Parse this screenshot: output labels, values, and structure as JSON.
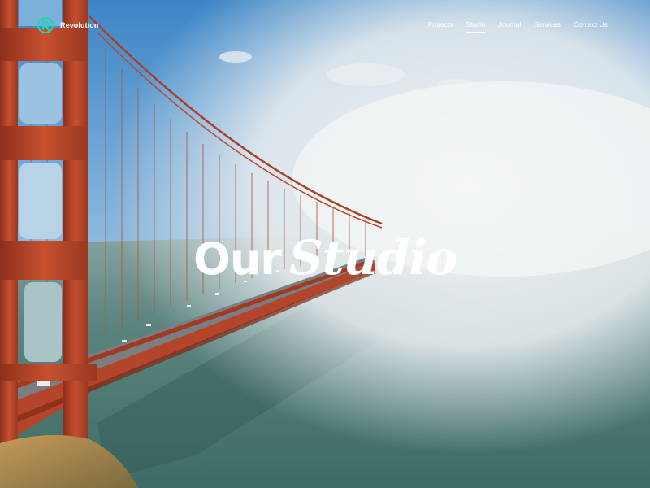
{
  "brand": {
    "name": "Revolution",
    "logo_icon": "r-logo-icon",
    "accent": "#1fd6b6"
  },
  "nav": {
    "items": [
      {
        "label": "Projects",
        "active": false
      },
      {
        "label": "Studio",
        "active": true
      },
      {
        "label": "Journal",
        "active": false
      },
      {
        "label": "Services",
        "active": false
      },
      {
        "label": "Contact Us",
        "active": false
      }
    ]
  },
  "hero": {
    "title_plain": "Our",
    "title_italic": "Studio"
  },
  "colors": {
    "sky": "#3e86c4",
    "fog": "#e9eef2",
    "water": "#4f756f",
    "bridge": "#b3452a"
  }
}
